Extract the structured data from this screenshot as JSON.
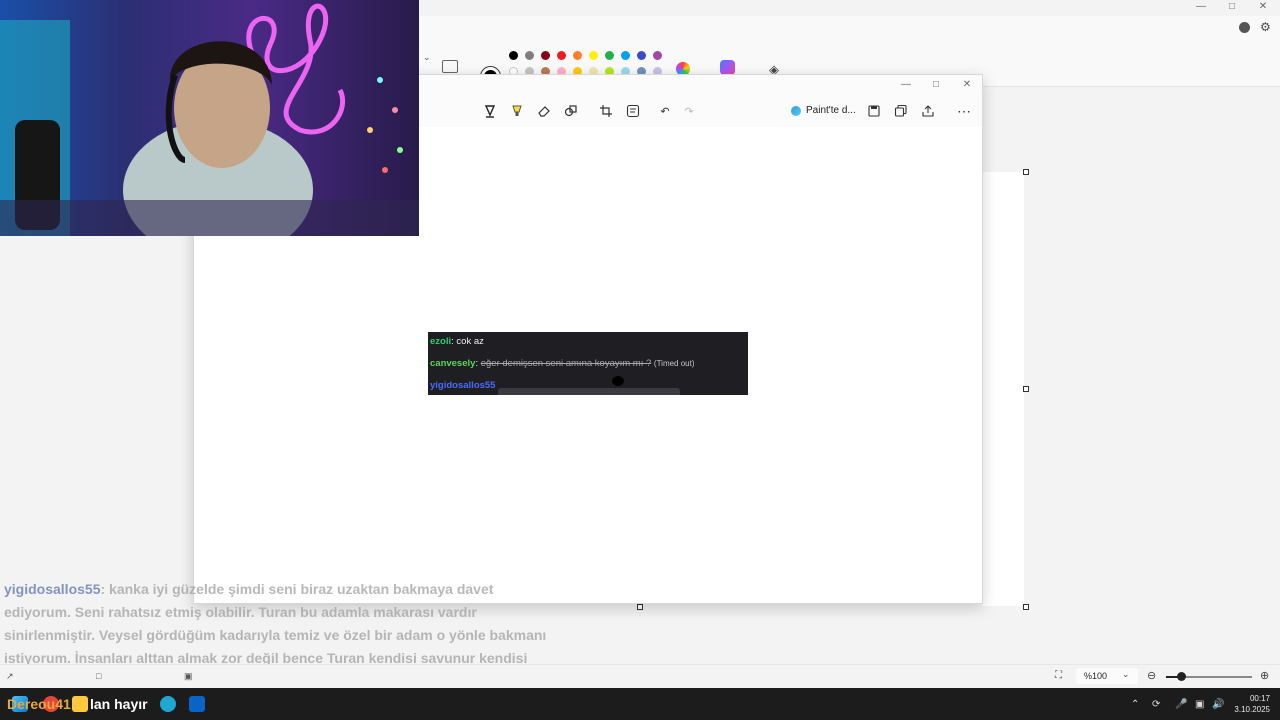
{
  "paint": {
    "palette_row1": [
      "#000000",
      "#7f7f7f",
      "#880015",
      "#ed1c24",
      "#ff7f27",
      "#fff200",
      "#22b14c",
      "#00a2e8",
      "#3f48cc",
      "#a349a4"
    ],
    "palette_row2": [
      "#ffffff",
      "#c3c3c3",
      "#b97a57",
      "#ffaec9",
      "#ffc90e",
      "#efe4b0",
      "#b5e61d",
      "#99d9ea",
      "#7092be",
      "#c8bfe7"
    ],
    "current_color": "#000000"
  },
  "snip": {
    "paint_open_label": "Paint'te d...",
    "screenshot": {
      "lines": [
        {
          "user": "ezoli",
          "user_color": "#2fce73",
          "text": "cok az"
        },
        {
          "user": "canvesely",
          "user_color": "#5cd65c",
          "text": "eğer demişsen seni amına koyayım mı ?",
          "note": "(Timed out)"
        },
        {
          "user": "yigidosallos55",
          "user_color": "#4b6bff",
          "text": ""
        }
      ]
    }
  },
  "overlay_chat": {
    "user": "yigidosallos55",
    "message": ": kanka iyi güzelde şimdi seni biraz uzaktan bakmaya davet ediyorum. Seni rahatsız etmiş olabilir. Turan bu adamla makarası vardır sinirlenmiştir. Veysel gördüğüm kadarıyla temiz ve özel bir adam o yönle bakmanı istiyorum. İnsanları alttan almak zor değil bence Turan kendisi savunur kendisi cevap verebilir diye düşünüyorum."
  },
  "statusbar": {
    "zoom": "%100"
  },
  "taskbar": {
    "overlay_name": "Dereou41",
    "overlay_text": "lan hayır",
    "time": "00:17",
    "date": "3.10.2025"
  }
}
